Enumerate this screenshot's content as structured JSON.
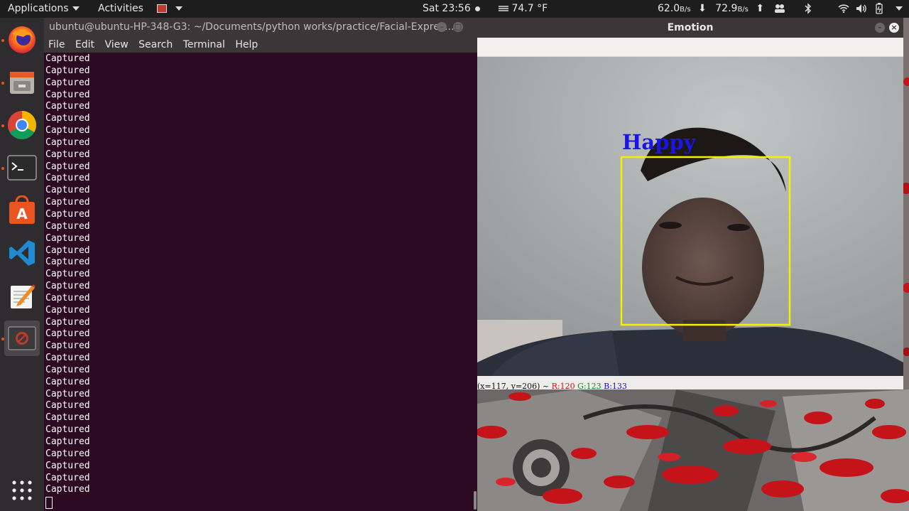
{
  "topbar": {
    "applications": "Applications",
    "activities": "Activities",
    "clock": "Sat 23:56",
    "temperature": "74.7 °F",
    "net_down": "62.0",
    "net_down_unit": "B/s",
    "net_up": "72.9",
    "net_up_unit": "B/s"
  },
  "dock": {
    "apps": [
      "firefox-icon",
      "files-icon",
      "chrome-icon",
      "terminal-icon",
      "software-center-icon",
      "vscode-icon",
      "text-editor-icon",
      "opencv-window-icon",
      "show-apps-icon"
    ]
  },
  "terminal": {
    "title": "ubuntu@ubuntu-HP-348-G3: ~/Documents/python works/practice/Facial-Expres...",
    "menu": [
      "File",
      "Edit",
      "View",
      "Search",
      "Terminal",
      "Help"
    ],
    "lines": [
      "Captured",
      "Captured",
      "Captured",
      "Captured",
      "Captured",
      "Captured",
      "Captured",
      "Captured",
      "Captured",
      "Captured",
      "Captured",
      "Captured",
      "Captured",
      "Captured",
      "Captured",
      "Captured",
      "Captured",
      "Captured",
      "Captured",
      "Captured",
      "Captured",
      "Captured",
      "Captured",
      "Captured",
      "Captured",
      "Captured",
      "Captured",
      "Captured",
      "Captured",
      "Captured",
      "Captured",
      "Captured",
      "Captured",
      "Captured",
      "Captured",
      "Captured",
      "Captured"
    ]
  },
  "emotion_window": {
    "title": "Emotion",
    "label": "Happy",
    "status_coords": "(x=117, y=206) ~",
    "status_r": "R:120",
    "status_g": "G:123",
    "status_b": "B:133"
  },
  "colors": {
    "terminal_bg": "#2c0b22",
    "label_color": "#1a14e6",
    "box_color": "#f2f200",
    "accent": "#e95420"
  }
}
